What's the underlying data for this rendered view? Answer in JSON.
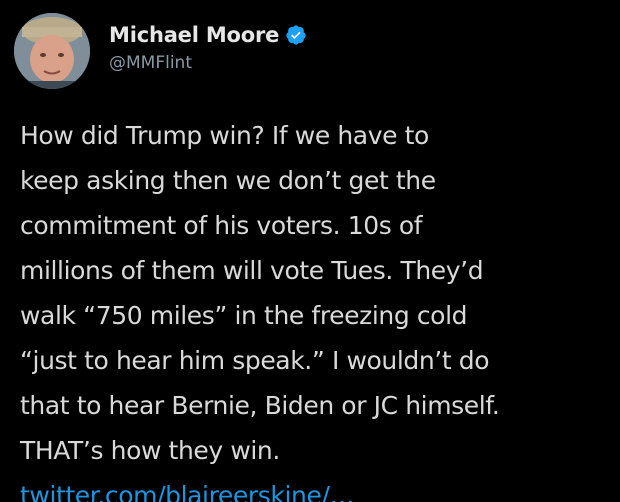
{
  "tweet": {
    "author": {
      "display_name": "Michael Moore",
      "handle": "@MMFlint",
      "verified": true
    },
    "body_lines": [
      "How did Trump win? If we have to",
      "keep asking then we don’t get the",
      "commitment of his voters. 10s of",
      "millions of them will vote Tues. They’d",
      "walk “750 miles” in the freezing cold",
      "“just to hear him speak.” I wouldn’t do",
      "that to hear Bernie, Biden or JC himself.",
      "THAT’s how they win."
    ],
    "link": "twitter.com/blaireerskine/…"
  },
  "colors": {
    "background": "#000000",
    "text": "#d9d9d9",
    "handle": "#8899a6",
    "link": "#1b95e0",
    "verified_badge": "#1da1f2"
  },
  "icons": {
    "verified": "verified-badge-icon",
    "avatar": "profile-photo"
  }
}
